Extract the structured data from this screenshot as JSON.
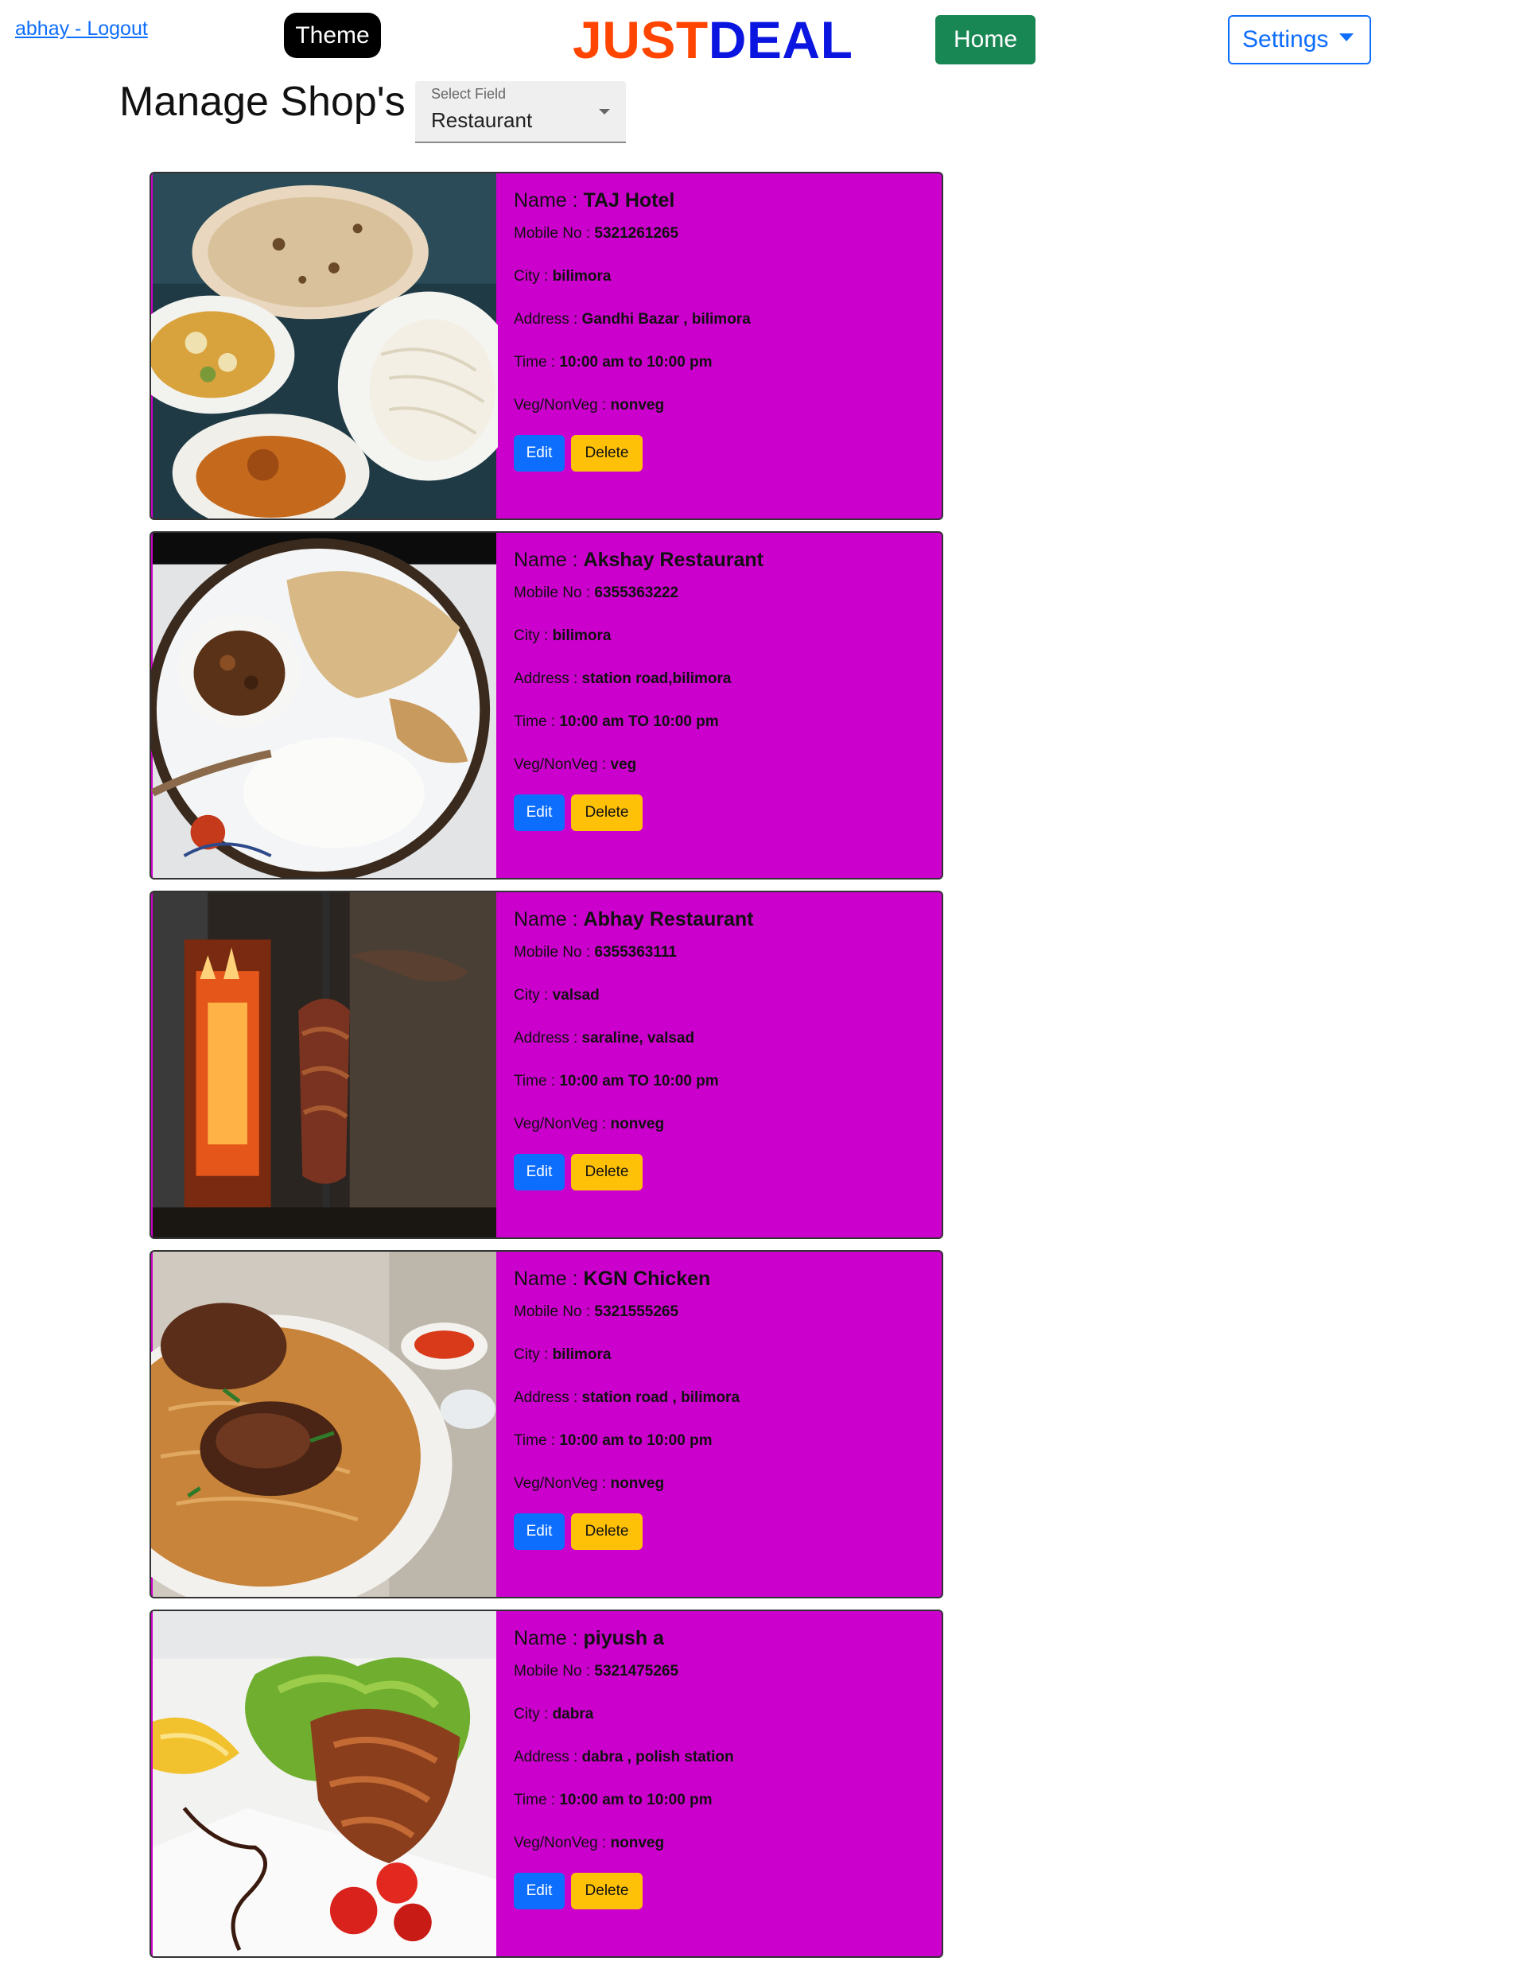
{
  "header": {
    "user_link": "abhay - Logout",
    "theme_label": "Theme",
    "brand_part1": "JUST",
    "brand_part2": "DEAL",
    "home_label": "Home",
    "settings_label": "Settings"
  },
  "page": {
    "title": "Manage Shop's",
    "select_label": "Select Field",
    "select_value": "Restaurant"
  },
  "labels": {
    "name": "Name : ",
    "mobile": "Mobile No : ",
    "city": "City : ",
    "address": "Address : ",
    "time": "Time : ",
    "vegnonveg": "Veg/NonVeg : ",
    "edit": "Edit",
    "delete": "Delete"
  },
  "shops": [
    {
      "name": "TAJ Hotel",
      "mobile": "5321261265",
      "city": "bilimora",
      "address": "Gandhi Bazar , bilimora",
      "time": "10:00 am to 10:00 pm",
      "vegnonveg": "nonveg",
      "image": "naan-curry-rice-plate"
    },
    {
      "name": "Akshay Restaurant",
      "mobile": "6355363222",
      "city": "bilimora",
      "address": "station road,bilimora",
      "time": "10:00 am TO 10:00 pm",
      "vegnonveg": "veg",
      "image": "roti-rice-thali-plate"
    },
    {
      "name": "Abhay Restaurant",
      "mobile": "6355363111",
      "city": "valsad",
      "address": "saraline, valsad",
      "time": "10:00 am TO 10:00 pm",
      "vegnonveg": "nonveg",
      "image": "shawarma-grill"
    },
    {
      "name": "KGN Chicken",
      "mobile": "5321555265",
      "city": "bilimora",
      "address": "station road , bilimora",
      "time": "10:00 am to 10:00 pm",
      "vegnonveg": "nonveg",
      "image": "chicken-biryani"
    },
    {
      "name": "piyush a",
      "mobile": "5321475265",
      "city": "dabra",
      "address": "dabra , polish station",
      "time": "10:00 am to 10:00 pm",
      "vegnonveg": "nonveg",
      "image": "grilled-fish-salad"
    }
  ],
  "colors": {
    "card_bg": "#cc00cc",
    "brand_orange": "#ff4500",
    "brand_blue": "#0a16e0",
    "home_green": "#198754",
    "edit_blue": "#0d6efd",
    "delete_yellow": "#ffc107"
  }
}
